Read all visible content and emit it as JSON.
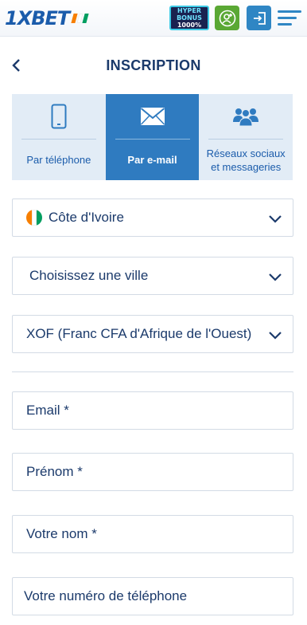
{
  "topbar": {
    "logo_text": "1XBET",
    "promo_line1": "HYPER",
    "promo_line2": "BONUS",
    "promo_line3": "1000%",
    "register_icon": "user-add-icon",
    "login_icon": "sign-in-icon",
    "menu_icon": "hamburger-menu-icon"
  },
  "header": {
    "back_icon": "chevron-left-icon",
    "title": "INSCRIPTION"
  },
  "tabs": [
    {
      "label": "Par téléphone",
      "icon": "smartphone-icon",
      "active": false
    },
    {
      "label": "Par e-mail",
      "icon": "envelope-icon",
      "active": true
    },
    {
      "label": "Réseaux sociaux et messageries",
      "icon": "people-group-icon",
      "active": false
    }
  ],
  "form": {
    "country": "Côte d'Ivoire",
    "city_placeholder": "Choisissez une ville",
    "currency": "XOF (Franc CFA d'Afrique de l'Ouest)",
    "email_label": "Email  *",
    "firstname_label": "Prénom  *",
    "lastname_label": "Votre nom  *",
    "phone_label": "Votre numéro de téléphone"
  },
  "colors": {
    "brand_blue": "#1b5cab",
    "active_tab": "#2f7bc0",
    "inactive_tab": "#e2ecf6",
    "text_dark": "#1b3a6b",
    "register_green": "#5aa834",
    "ci_flag": [
      "#f77f00",
      "#ffffff",
      "#009e60"
    ]
  }
}
